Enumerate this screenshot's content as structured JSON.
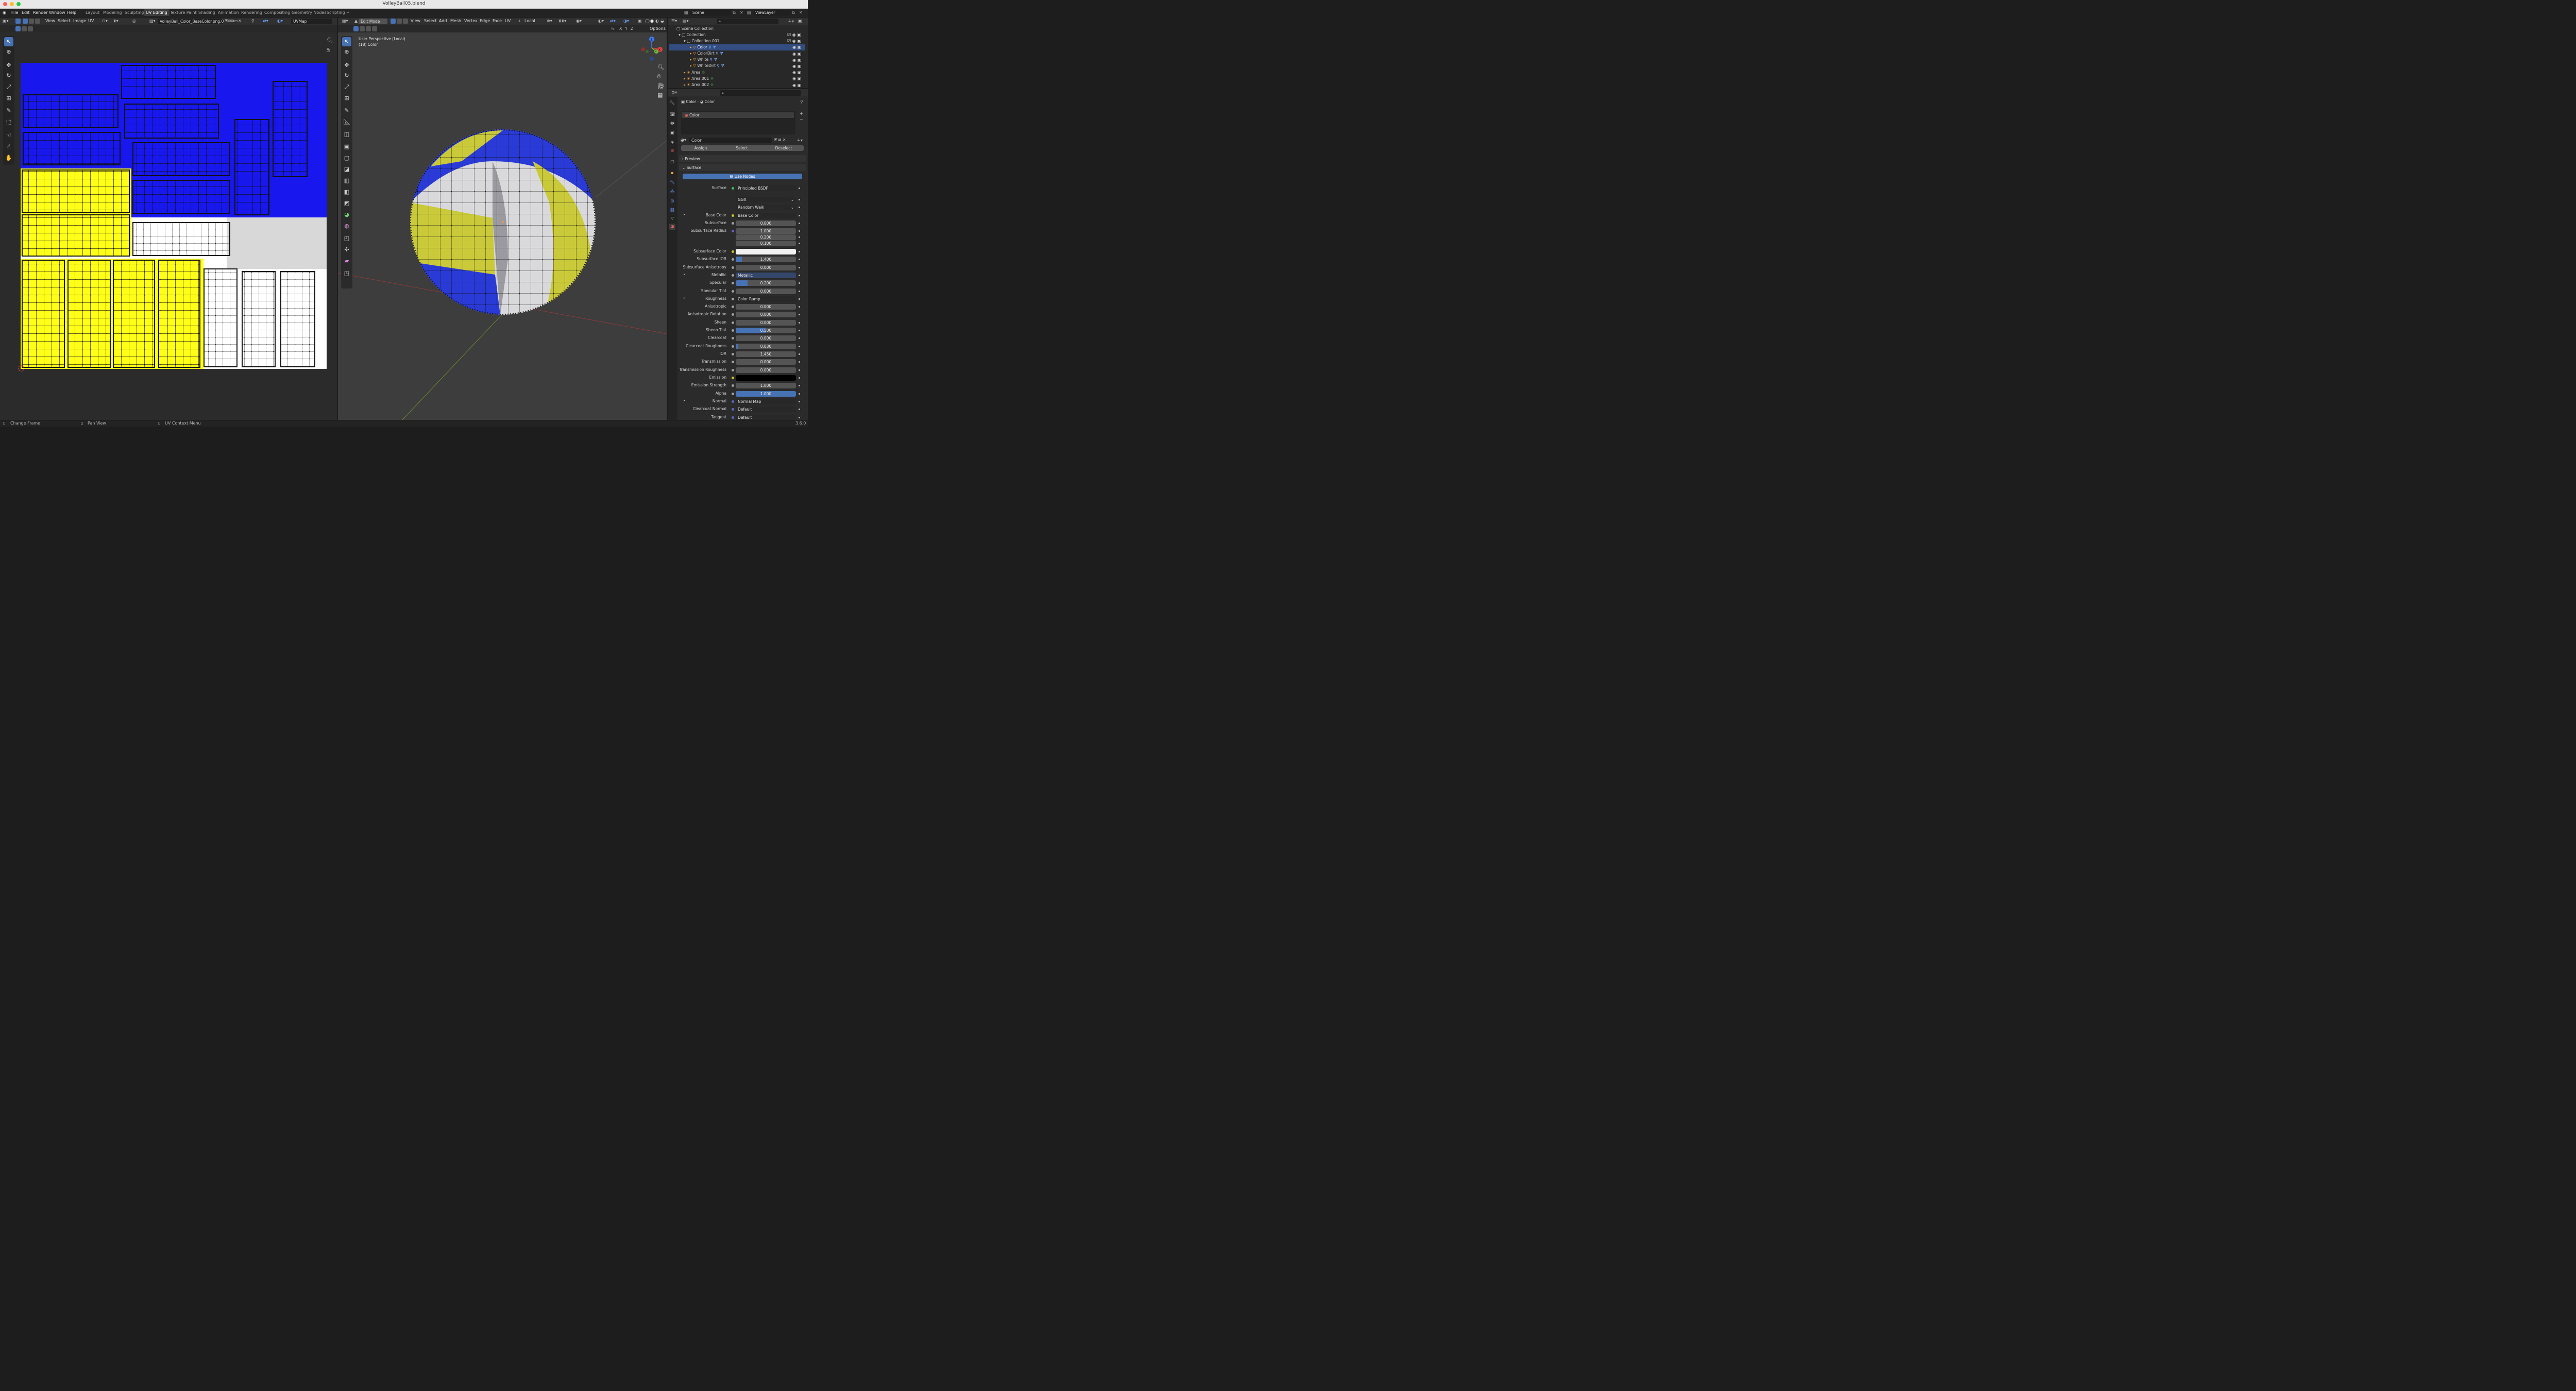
{
  "window": {
    "title": "VolleyBall05.blend"
  },
  "menu": [
    "File",
    "Edit",
    "Render",
    "Window",
    "Help"
  ],
  "workspaces": [
    "Layout",
    "Modeling",
    "Sculpting",
    "UV Editing",
    "Texture Paint",
    "Shading",
    "Animation",
    "Rendering",
    "Compositing",
    "Geometry Nodes",
    "Scripting"
  ],
  "workspace_add": "+",
  "active_workspace": "UV Editing",
  "scene": {
    "name": "Scene",
    "view_layer": "ViewLayer"
  },
  "uv_editor": {
    "menus": [
      "View",
      "Select",
      "Image",
      "UV"
    ],
    "image_name": "VolleyBall_Color_BaseColor.png.001",
    "uv_map": "UVMap"
  },
  "viewport": {
    "mode": "Edit Mode",
    "menus": [
      "View",
      "Select",
      "Add",
      "Mesh",
      "Vertex",
      "Edge",
      "Face",
      "UV"
    ],
    "orientation": "Local",
    "info_line1": "User Perspective (Local)",
    "info_line2": "(18) Color",
    "options_label": "Options",
    "axes": [
      "X",
      "Y",
      "Z"
    ],
    "gizmo": {
      "x": "X",
      "y": "Y",
      "z": "Z"
    }
  },
  "outliner": {
    "root": "Scene Collection",
    "items": [
      {
        "label": "Collection"
      },
      {
        "label": "Collection.001"
      },
      {
        "label": "Color"
      },
      {
        "label": "ColorDirt"
      },
      {
        "label": "White"
      },
      {
        "label": "WhiteDirt"
      },
      {
        "label": "Area"
      },
      {
        "label": "Area.001"
      },
      {
        "label": "Area.002"
      }
    ]
  },
  "properties": {
    "breadcrumb": [
      "Color",
      "Color"
    ],
    "material_slot": "Color",
    "material_name": "Color",
    "assign": "Assign",
    "select": "Select",
    "deselect": "Deselect",
    "preview": "Preview",
    "surface_panel": "Surface",
    "use_nodes": "Use Nodes",
    "rows": [
      {
        "label": "Surface",
        "kind": "link",
        "value": "Principled BSDF",
        "dot": "#3fbf5f"
      },
      {
        "label": "",
        "kind": "enum",
        "value": "GGX"
      },
      {
        "label": "",
        "kind": "enum",
        "value": "Random Walk"
      },
      {
        "label": "Base Color",
        "kind": "link",
        "value": "Base Color",
        "dot": "#c7c729",
        "expand": true
      },
      {
        "label": "Subsurface",
        "kind": "num",
        "value": "0.000",
        "dot": "#a1a1a1",
        "fill": 0
      },
      {
        "label": "Subsurface Radius",
        "kind": "num",
        "value": "1.000",
        "dot": "#6363c7",
        "fill": 0
      },
      {
        "label": "",
        "kind": "num",
        "value": "0.200",
        "fill": 0
      },
      {
        "label": "",
        "kind": "num",
        "value": "0.100",
        "fill": 0
      },
      {
        "label": "Subsurface Color",
        "kind": "color",
        "value": "#f2f2f2",
        "dot": "#c7c729"
      },
      {
        "label": "Subsurface IOR",
        "kind": "num",
        "value": "1.400",
        "dot": "#a1a1a1",
        "fill": 0.1
      },
      {
        "label": "Subsurface Anisotropy",
        "kind": "num",
        "value": "0.000",
        "dot": "#a1a1a1",
        "fill": 0
      },
      {
        "label": "Metallic",
        "kind": "link",
        "value": "Metallic",
        "dot": "#a1a1a1",
        "expand": true,
        "blue": true
      },
      {
        "label": "Specular",
        "kind": "num",
        "value": "0.200",
        "dot": "#a1a1a1",
        "fill": 0.2
      },
      {
        "label": "Specular Tint",
        "kind": "num",
        "value": "0.000",
        "dot": "#a1a1a1",
        "fill": 0
      },
      {
        "label": "Roughness",
        "kind": "link",
        "value": "Color Ramp",
        "dot": "#a1a1a1",
        "expand": true
      },
      {
        "label": "Anisotropic",
        "kind": "num",
        "value": "0.000",
        "dot": "#a1a1a1",
        "fill": 0
      },
      {
        "label": "Anisotropic Rotation",
        "kind": "num",
        "value": "0.000",
        "dot": "#a1a1a1",
        "fill": 0
      },
      {
        "label": "Sheen",
        "kind": "num",
        "value": "0.000",
        "dot": "#a1a1a1",
        "fill": 0
      },
      {
        "label": "Sheen Tint",
        "kind": "num",
        "value": "0.500",
        "dot": "#a1a1a1",
        "fill": 0.5
      },
      {
        "label": "Clearcoat",
        "kind": "num",
        "value": "0.000",
        "dot": "#a1a1a1",
        "fill": 0
      },
      {
        "label": "Clearcoat Roughness",
        "kind": "num",
        "value": "0.030",
        "dot": "#a1a1a1",
        "fill": 0.03
      },
      {
        "label": "IOR",
        "kind": "num",
        "value": "1.450",
        "dot": "#a1a1a1",
        "fill": 0
      },
      {
        "label": "Transmission",
        "kind": "num",
        "value": "0.000",
        "dot": "#a1a1a1",
        "fill": 0
      },
      {
        "label": "Transmission Roughness",
        "kind": "num",
        "value": "0.000",
        "dot": "#a1a1a1",
        "fill": 0
      },
      {
        "label": "Emission",
        "kind": "color",
        "value": "#000000",
        "dot": "#c7c729"
      },
      {
        "label": "Emission Strength",
        "kind": "num",
        "value": "1.000",
        "dot": "#a1a1a1",
        "fill": 0
      },
      {
        "label": "Alpha",
        "kind": "num",
        "value": "1.000",
        "dot": "#a1a1a1",
        "fill": 1
      },
      {
        "label": "Normal",
        "kind": "link",
        "value": "Normal Map",
        "dot": "#6363c7",
        "expand": true
      },
      {
        "label": "Clearcoat Normal",
        "kind": "link",
        "value": "Default",
        "dot": "#6363c7"
      },
      {
        "label": "Tangent",
        "kind": "link",
        "value": "Default",
        "dot": "#6363c7"
      }
    ]
  },
  "status": {
    "left": "Change Frame",
    "mid": "Pan View",
    "right": "UV Context Menu",
    "version": "3.6.0"
  },
  "colors": {
    "accent": "#4772b3",
    "uv_blue": "#1818ee",
    "uv_yellow": "#ffff18",
    "ball_blue": "#2a3ad6",
    "ball_yellow": "#c9c93a"
  }
}
